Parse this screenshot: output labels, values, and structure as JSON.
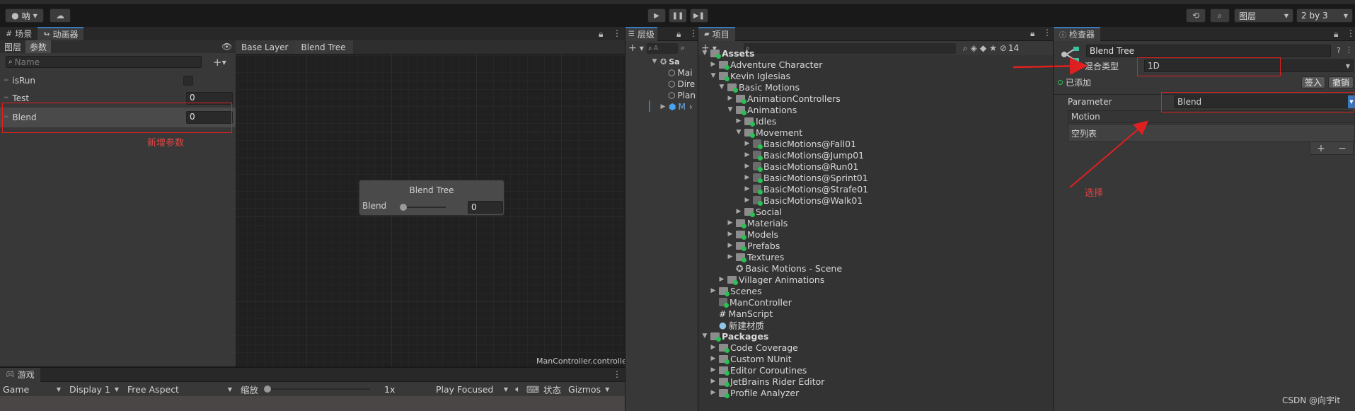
{
  "toolbar": {
    "account_label": "呐",
    "play_icon": "play-icon",
    "layers_label": "图层",
    "layout_label": "2 by 3"
  },
  "scene_tabs": {
    "scene": "场景",
    "animator": "动画器"
  },
  "animator": {
    "subtabs": {
      "layers": "图层",
      "params": "参数"
    },
    "search_placeholder": "Name",
    "breadcrumb": [
      "Base Layer",
      "Blend Tree"
    ],
    "params": [
      {
        "name": "isRun",
        "type": "bool",
        "value": ""
      },
      {
        "name": "Test",
        "type": "float",
        "value": "0"
      },
      {
        "name": "Blend",
        "type": "float",
        "value": "0"
      }
    ],
    "annotation_new_param": "新增参数",
    "node": {
      "title": "Blend Tree",
      "param": "Blend",
      "value": "0",
      "slider": 0
    },
    "footer_file": "ManController.controller"
  },
  "game": {
    "tab": "游戏",
    "display_mode": "Game",
    "display": "Display 1",
    "aspect": "Free Aspect",
    "zoom_label": "缩放",
    "zoom_value": "1x",
    "play_focused": "Play Focused",
    "stats": "状态",
    "gizmos": "Gizmos"
  },
  "hierarchy": {
    "tab": "层级",
    "search_placeholder": "A",
    "items": [
      "Sa",
      "Mai",
      "Dire",
      "Plan",
      "M"
    ]
  },
  "project": {
    "tab": "项目",
    "hidden_count": "14",
    "tree": [
      {
        "label": "Assets",
        "depth": 0,
        "bold": true,
        "arrow": "▼",
        "kind": "folder"
      },
      {
        "label": "Adventure Character",
        "depth": 1,
        "arrow": "▶",
        "kind": "folder"
      },
      {
        "label": "Kevin Iglesias",
        "depth": 1,
        "arrow": "▼",
        "kind": "folder"
      },
      {
        "label": "Basic Motions",
        "depth": 2,
        "arrow": "▼",
        "kind": "folder"
      },
      {
        "label": "AnimationControllers",
        "depth": 3,
        "arrow": "▶",
        "kind": "folder"
      },
      {
        "label": "Animations",
        "depth": 3,
        "arrow": "▼",
        "kind": "folder"
      },
      {
        "label": "Idles",
        "depth": 4,
        "arrow": "▶",
        "kind": "folder"
      },
      {
        "label": "Movement",
        "depth": 4,
        "arrow": "▼",
        "kind": "folder"
      },
      {
        "label": "BasicMotions@Fall01",
        "depth": 5,
        "arrow": "▶",
        "kind": "anim"
      },
      {
        "label": "BasicMotions@Jump01",
        "depth": 5,
        "arrow": "▶",
        "kind": "anim"
      },
      {
        "label": "BasicMotions@Run01",
        "depth": 5,
        "arrow": "▶",
        "kind": "anim"
      },
      {
        "label": "BasicMotions@Sprint01",
        "depth": 5,
        "arrow": "▶",
        "kind": "anim"
      },
      {
        "label": "BasicMotions@Strafe01",
        "depth": 5,
        "arrow": "▶",
        "kind": "anim"
      },
      {
        "label": "BasicMotions@Walk01",
        "depth": 5,
        "arrow": "▶",
        "kind": "anim"
      },
      {
        "label": "Social",
        "depth": 4,
        "arrow": "▶",
        "kind": "folder"
      },
      {
        "label": "Materials",
        "depth": 3,
        "arrow": "▶",
        "kind": "folder"
      },
      {
        "label": "Models",
        "depth": 3,
        "arrow": "▶",
        "kind": "folder"
      },
      {
        "label": "Prefabs",
        "depth": 3,
        "arrow": "▶",
        "kind": "folder"
      },
      {
        "label": "Textures",
        "depth": 3,
        "arrow": "▶",
        "kind": "folder"
      },
      {
        "label": "Basic Motions - Scene",
        "depth": 3,
        "arrow": "",
        "kind": "scene"
      },
      {
        "label": "Villager Animations",
        "depth": 2,
        "arrow": "▶",
        "kind": "folder"
      },
      {
        "label": "Scenes",
        "depth": 1,
        "arrow": "▶",
        "kind": "folder"
      },
      {
        "label": "ManController",
        "depth": 1,
        "arrow": "",
        "kind": "anim"
      },
      {
        "label": "ManScript",
        "depth": 1,
        "arrow": "",
        "kind": "script"
      },
      {
        "label": "新建材质",
        "depth": 1,
        "arrow": "",
        "kind": "material"
      },
      {
        "label": "Packages",
        "depth": 0,
        "bold": true,
        "arrow": "▼",
        "kind": "folder"
      },
      {
        "label": "Code Coverage",
        "depth": 1,
        "arrow": "▶",
        "kind": "folder"
      },
      {
        "label": "Custom NUnit",
        "depth": 1,
        "arrow": "▶",
        "kind": "folder"
      },
      {
        "label": "Editor Coroutines",
        "depth": 1,
        "arrow": "▶",
        "kind": "folder"
      },
      {
        "label": "JetBrains Rider Editor",
        "depth": 1,
        "arrow": "▶",
        "kind": "folder"
      },
      {
        "label": "Profile Analyzer",
        "depth": 1,
        "arrow": "▶",
        "kind": "folder"
      }
    ]
  },
  "inspector": {
    "tab": "检查器",
    "object_name": "Blend Tree",
    "blend_type_label": "混合类型",
    "blend_type_value": "1D",
    "added_label": "已添加",
    "sign_in": "签入",
    "revert": "撤销",
    "parameter_label": "Parameter",
    "parameter_value": "Blend",
    "motion_label": "Motion",
    "empty_list": "空列表",
    "annotation_select": "选择"
  },
  "watermark": "CSDN @向宇it",
  "colors": {
    "accent": "#3a79bb",
    "annotation": "#e02020",
    "asset_badge": "#2bbf55"
  }
}
